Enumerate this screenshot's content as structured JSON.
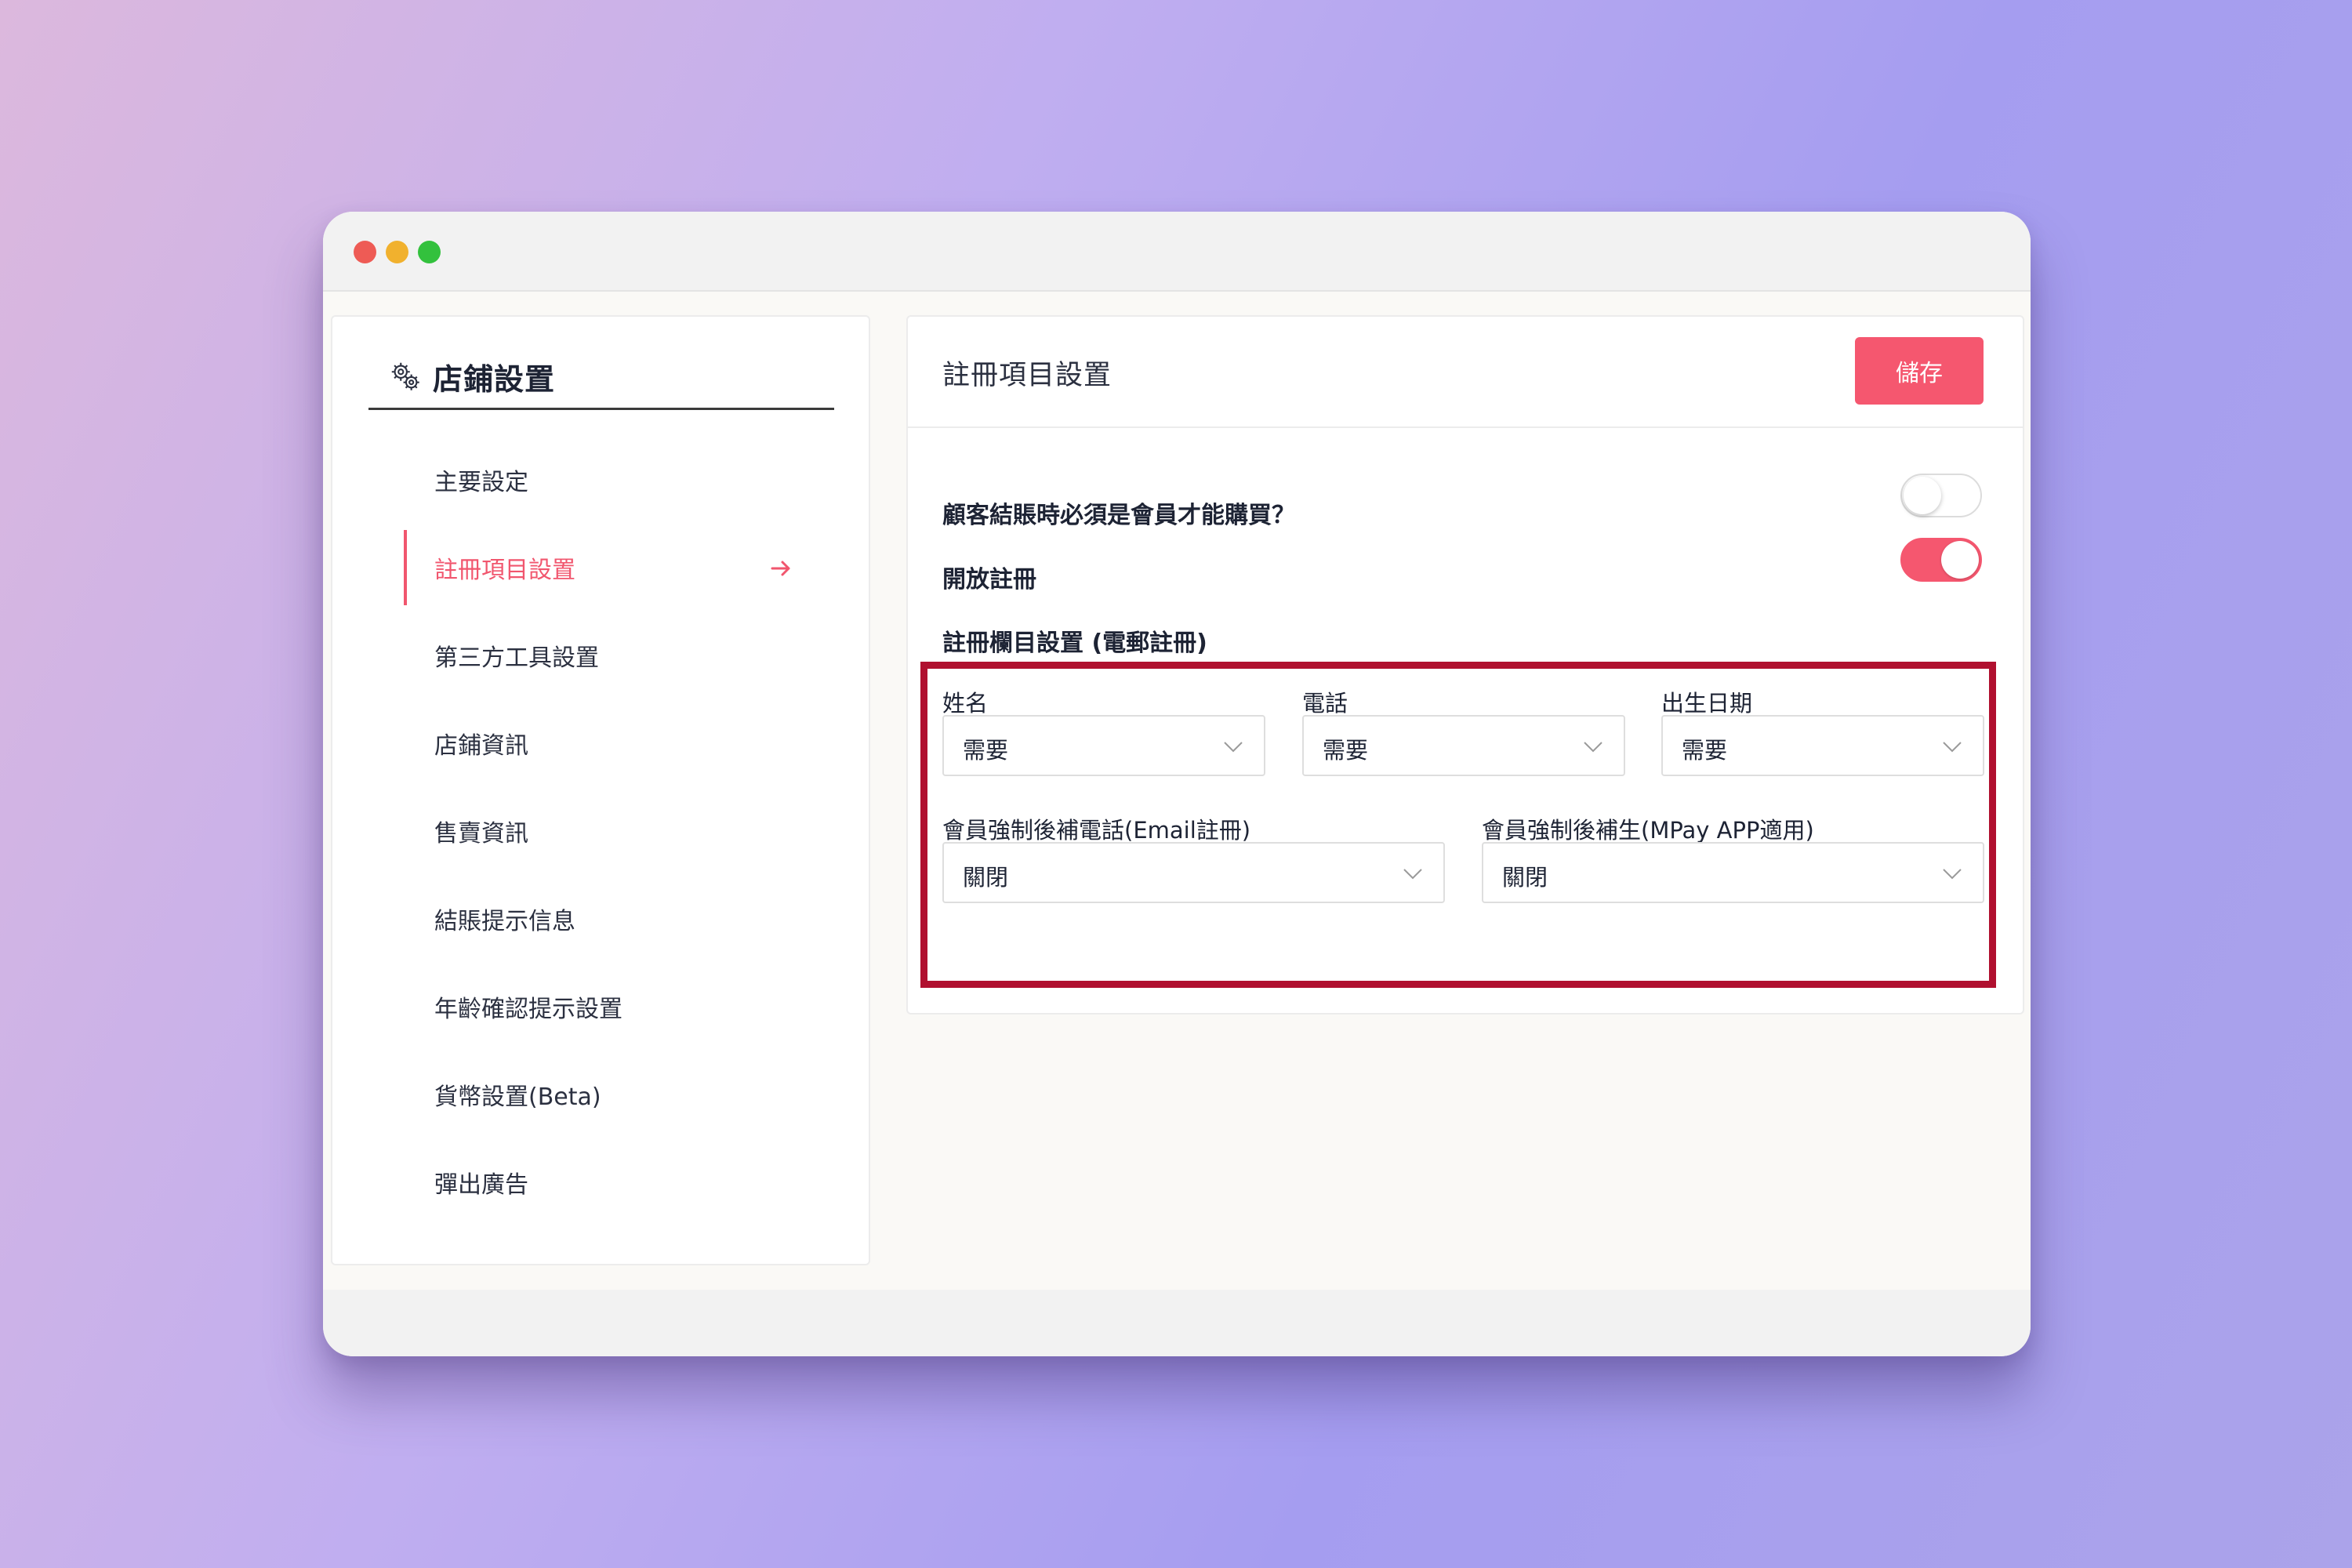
{
  "sidebar": {
    "title": "店鋪設置",
    "items": [
      {
        "label": "主要設定"
      },
      {
        "label": "註冊項目設置"
      },
      {
        "label": "第三方工具設置"
      },
      {
        "label": "店鋪資訊"
      },
      {
        "label": "售賣資訊"
      },
      {
        "label": "結賬提示信息"
      },
      {
        "label": "年齡確認提示設置"
      },
      {
        "label": "貨幣設置(Beta)"
      },
      {
        "label": "彈出廣告"
      }
    ],
    "active_index": 1
  },
  "main": {
    "title": "註冊項目設置",
    "save_label": "儲存",
    "member_required": {
      "label": "顧客結賬時必須是會員才能購買？",
      "enabled": false
    },
    "open_registration": {
      "label": "開放註冊",
      "enabled": true
    },
    "fields_section_title": "註冊欄目設置 (電郵註冊)",
    "fields": {
      "name": {
        "label": "姓名",
        "value": "需要"
      },
      "phone": {
        "label": "電話",
        "value": "需要"
      },
      "birthday": {
        "label": "出生日期",
        "value": "需要"
      },
      "force_phone": {
        "label": "會員強制後補電話(Email註冊)",
        "value": "關閉"
      },
      "force_birthday": {
        "label": "會員強制後補生(MPay APP適用)",
        "value": "關閉"
      }
    }
  },
  "colors": {
    "accent": "#f5576f",
    "highlight_border": "#b0102f"
  },
  "icons": {
    "settings": "gear-icon",
    "active_nav": "arrow-right-icon",
    "select": "chevron-down-icon"
  }
}
